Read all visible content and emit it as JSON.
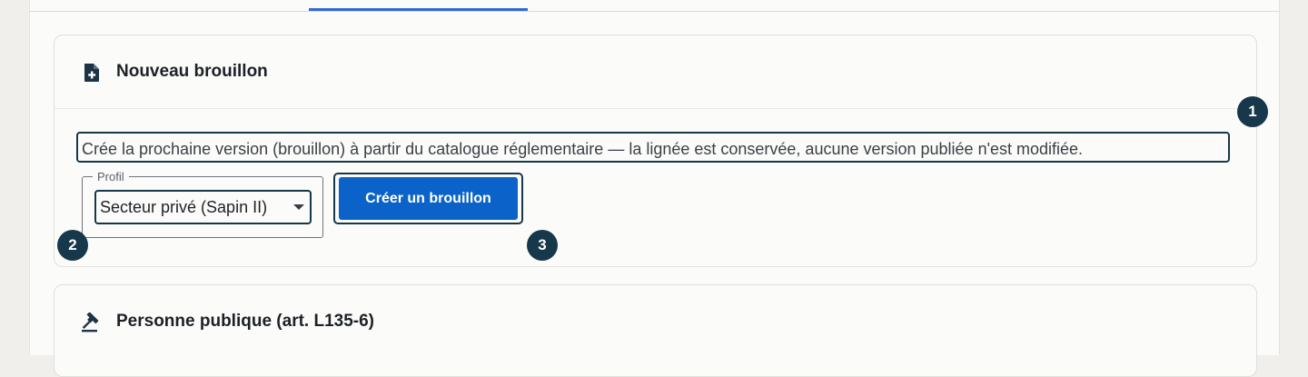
{
  "new_draft_card": {
    "title": "Nouveau brouillon",
    "header_icon": "file-plus-icon",
    "description": "Crée la prochaine version (brouillon) à partir du catalogue réglementaire — la lignée est conservée, aucune version publiée n'est modifiée.",
    "profile_field": {
      "legend": "Profil",
      "selected": "Secteur privé (Sapin II)"
    },
    "create_button_label": "Créer un brouillon"
  },
  "public_entity_card": {
    "title": "Personne publique (art. L135-6)",
    "header_icon": "gavel-icon"
  },
  "markers": [
    "1",
    "2",
    "3"
  ]
}
